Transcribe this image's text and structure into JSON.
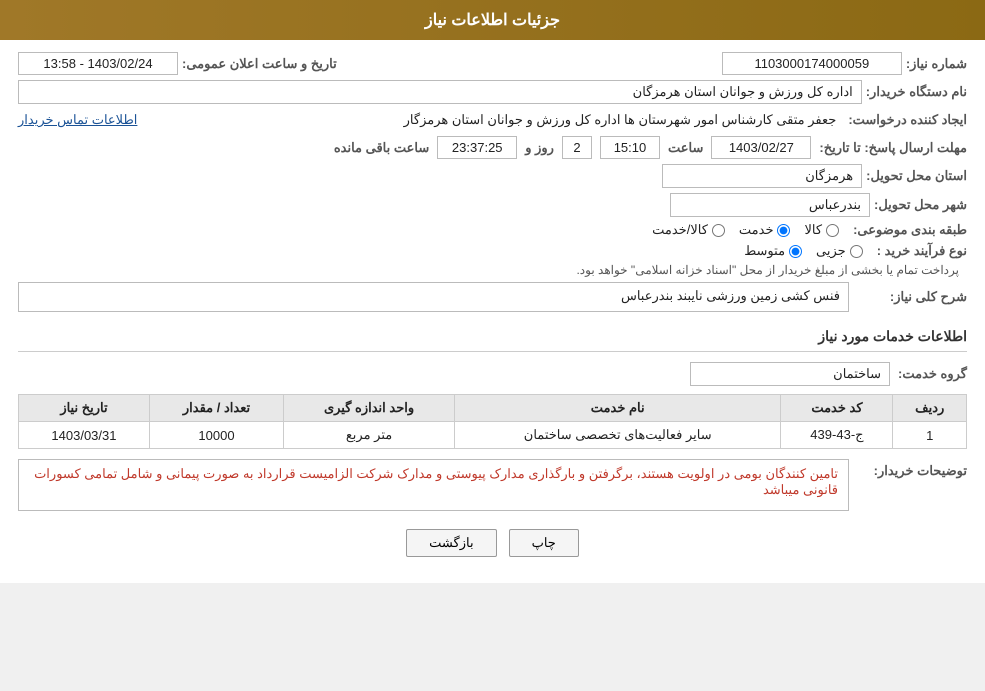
{
  "header": {
    "title": "جزئیات اطلاعات نیاز"
  },
  "fields": {
    "shomara_niaz_label": "شماره نیاز:",
    "shomara_niaz_value": "1103000174000059",
    "nam_dastgah_label": "نام دستگاه خریدار:",
    "nam_dastgah_value": "اداره کل ورزش و جوانان استان هرمزگان",
    "ijad_label": "ایجاد کننده درخواست:",
    "ijad_value": "جعفر متقی کارشناس امور شهرستان ها اداره کل ورزش و جوانان استان هرمزگار",
    "ettelaat_tamas_label": "اطلاعات تماس خریدار",
    "mohlat_label": "مهلت ارسال پاسخ: تا تاریخ:",
    "mohlat_date": "1403/02/27",
    "mohlat_saat_label": "ساعت",
    "mohlat_saat_value": "15:10",
    "mohlat_roz_label": "روز و",
    "mohlat_roz_value": "2",
    "mohlat_baqi_label": "ساعت باقی مانده",
    "mohlat_baqi_value": "23:37:25",
    "tarikh_label": "تاریخ و ساعت اعلان عمومی:",
    "tarikh_value": "1403/02/24 - 13:58",
    "ostan_tahvil_label": "استان محل تحویل:",
    "ostan_tahvil_value": "هرمزگان",
    "shahr_tahvil_label": "شهر محل تحویل:",
    "shahr_tahvil_value": "بندرعباس",
    "tabaqe_label": "طبقه بندی موضوعی:",
    "radios_tabaqe": [
      {
        "id": "kala",
        "label": "کالا",
        "checked": false
      },
      {
        "id": "khedmat",
        "label": "خدمت",
        "checked": true
      },
      {
        "id": "kala_khedmat",
        "label": "کالا/خدمت",
        "checked": false
      }
    ],
    "nooe_farayand_label": "نوع فرآیند خرید :",
    "radios_farayand": [
      {
        "id": "jozvi",
        "label": "جزیی",
        "checked": false
      },
      {
        "id": "motavaset",
        "label": "متوسط",
        "checked": true
      }
    ],
    "farayand_note": "پرداخت تمام یا بخشی از مبلغ خریدار از محل \"اسناد خزانه اسلامی\" خواهد بود.",
    "sharh_label": "شرح کلی نیاز:",
    "sharh_value": "فنس کشی زمین ورزشی نایبند بندرعباس",
    "section2_title": "اطلاعات خدمات مورد نیاز",
    "gorohe_khedmat_label": "گروه خدمت:",
    "gorohe_khedmat_value": "ساختمان",
    "table": {
      "headers": [
        "ردیف",
        "کد خدمت",
        "نام خدمت",
        "واحد اندازه گیری",
        "تعداد / مقدار",
        "تاریخ نیاز"
      ],
      "rows": [
        {
          "radif": "1",
          "kod": "ج-43-439",
          "name": "سایر فعالیت‌های تخصصی ساختمان",
          "vahed": "متر مربع",
          "tedad": "10000",
          "tarikh": "1403/03/31"
        }
      ]
    },
    "tozihat_label": "توضیحات خریدار:",
    "tozihat_value": "تامین کنندگان بومی در اولویت هستند، برگرفتن و بارگذاری مدارک پیوستی  و  مدارک شرکت الزامیست   قرارداد به صورت پیمانی و شامل تمامی کسورات قانونی میباشد",
    "btn_chap": "چاپ",
    "btn_bazgasht": "بازگشت"
  }
}
